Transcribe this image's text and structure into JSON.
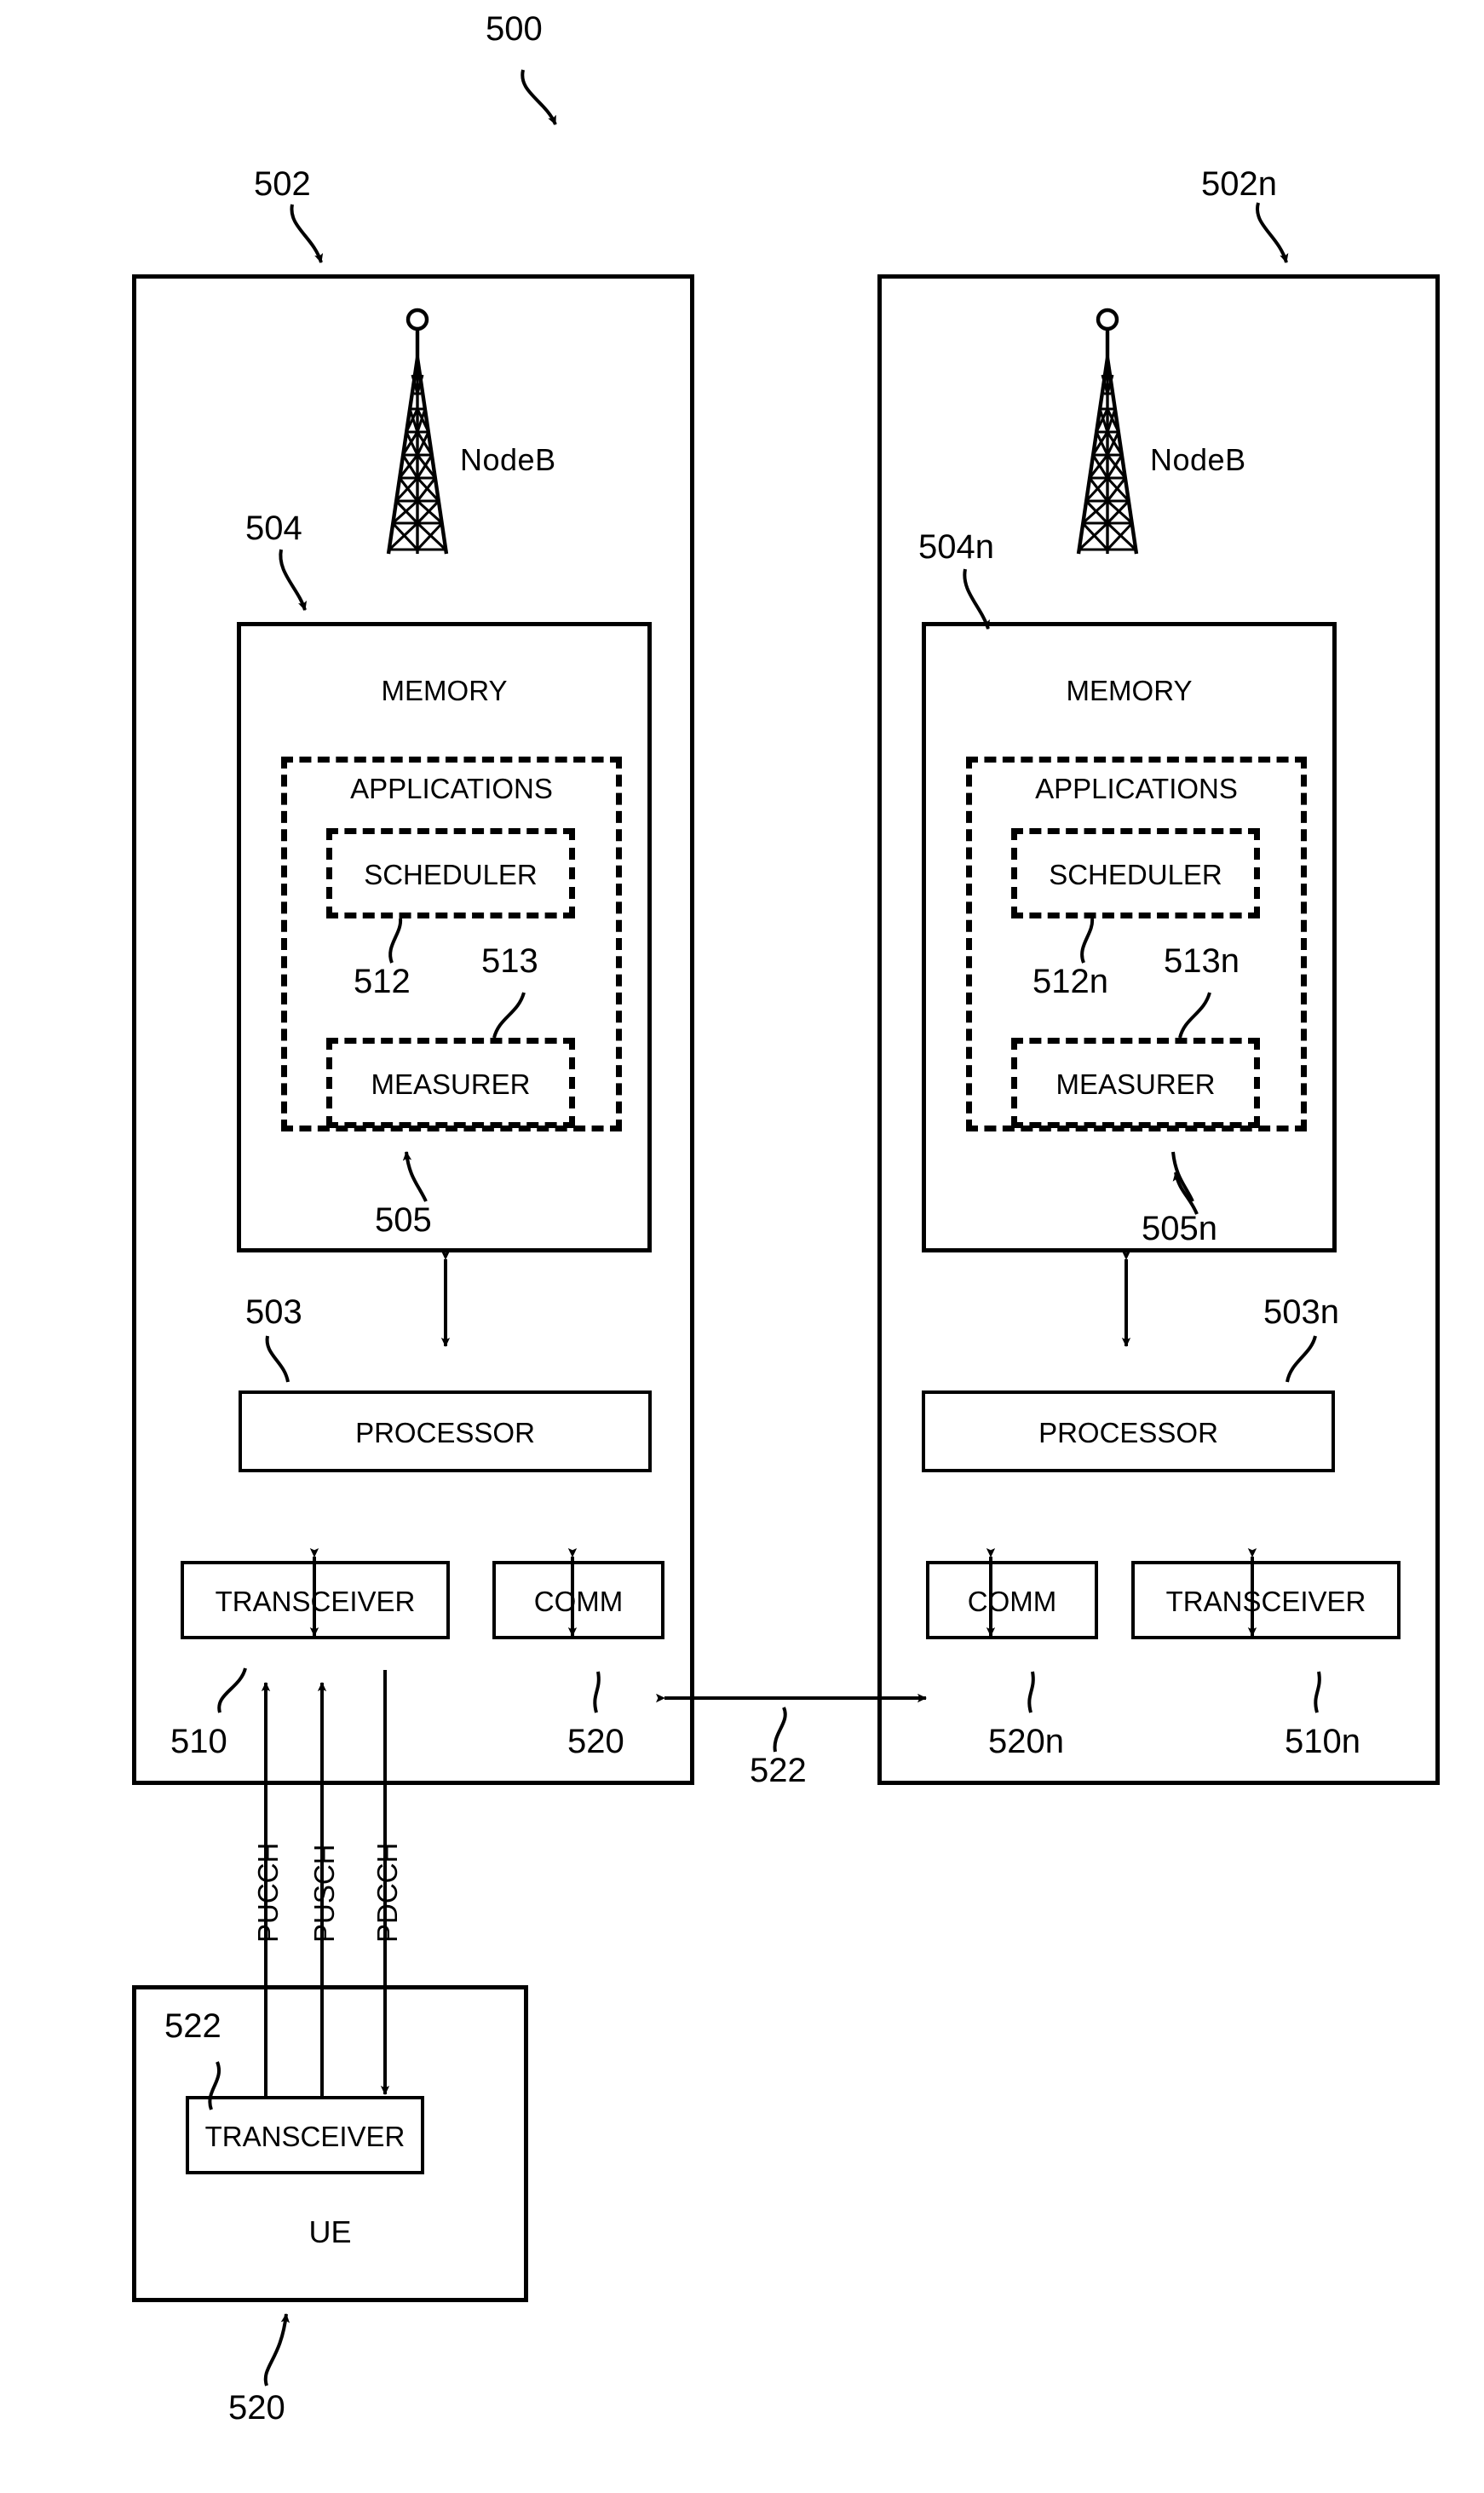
{
  "figure": {
    "ref_500": "500"
  },
  "nodeb_left": {
    "panel_ref": "502",
    "tower_label": "NodeB",
    "memory": {
      "title": "MEMORY",
      "ref": "504",
      "applications": {
        "title": "APPLICATIONS",
        "ref": "505",
        "scheduler": {
          "title": "SCHEDULER",
          "ref": "512"
        },
        "measurer": {
          "title": "MEASURER",
          "ref": "513"
        }
      }
    },
    "processor": {
      "title": "PROCESSOR",
      "ref": "503"
    },
    "transceiver": {
      "title": "TRANSCEIVER",
      "ref": "510"
    },
    "comm": {
      "title": "COMM",
      "ref": "520"
    }
  },
  "nodeb_right": {
    "panel_ref": "502n",
    "tower_label": "NodeB",
    "memory": {
      "title": "MEMORY",
      "ref": "504n",
      "applications": {
        "title": "APPLICATIONS",
        "ref": "505n",
        "scheduler": {
          "title": "SCHEDULER",
          "ref": "512n"
        },
        "measurer": {
          "title": "MEASURER",
          "ref": "513n"
        }
      }
    },
    "processor": {
      "title": "PROCESSOR",
      "ref": "503n"
    },
    "transceiver": {
      "title": "TRANSCEIVER",
      "ref": "510n"
    },
    "comm": {
      "title": "COMM",
      "ref": "520n"
    }
  },
  "interconnect": {
    "ref": "522"
  },
  "ue": {
    "title": "UE",
    "ref": "520",
    "transceiver": {
      "title": "TRANSCEIVER",
      "ref": "522"
    }
  },
  "channels": [
    {
      "name": "PUCCH",
      "direction": "uplink"
    },
    {
      "name": "PUSCH",
      "direction": "uplink"
    },
    {
      "name": "PDCCH",
      "direction": "downlink"
    }
  ],
  "colors": {
    "ink": "#000000",
    "paper": "#ffffff"
  }
}
